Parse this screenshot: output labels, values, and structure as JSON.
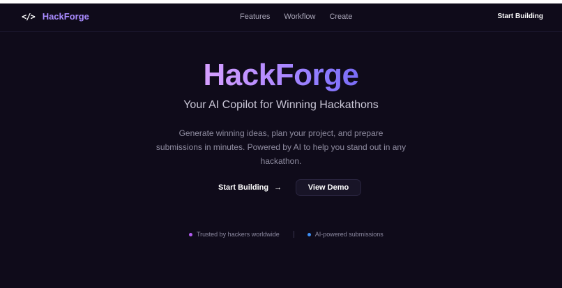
{
  "nav": {
    "brand_icon": "</>",
    "brand_name": "HackForge",
    "links": [
      "Features",
      "Workflow",
      "Create"
    ],
    "cta": "Start Building"
  },
  "hero": {
    "title": "HackForge",
    "subtitle": "Your AI Copilot for Winning Hackathons",
    "description": "Generate winning ideas, plan your project, and prepare submissions in minutes. Powered by AI to help you stand out in any hackathon."
  },
  "buttons": {
    "primary": "Start Building",
    "primary_icon": "→",
    "secondary": "View Demo"
  },
  "trust": [
    {
      "text": "Trusted by hackers worldwide",
      "color": "#b35cf2"
    },
    {
      "text": "AI-powered submissions",
      "color": "#3d8ff5"
    }
  ],
  "colors": {
    "background": "#0f0b1a",
    "brand_accent": "#a98bff"
  }
}
